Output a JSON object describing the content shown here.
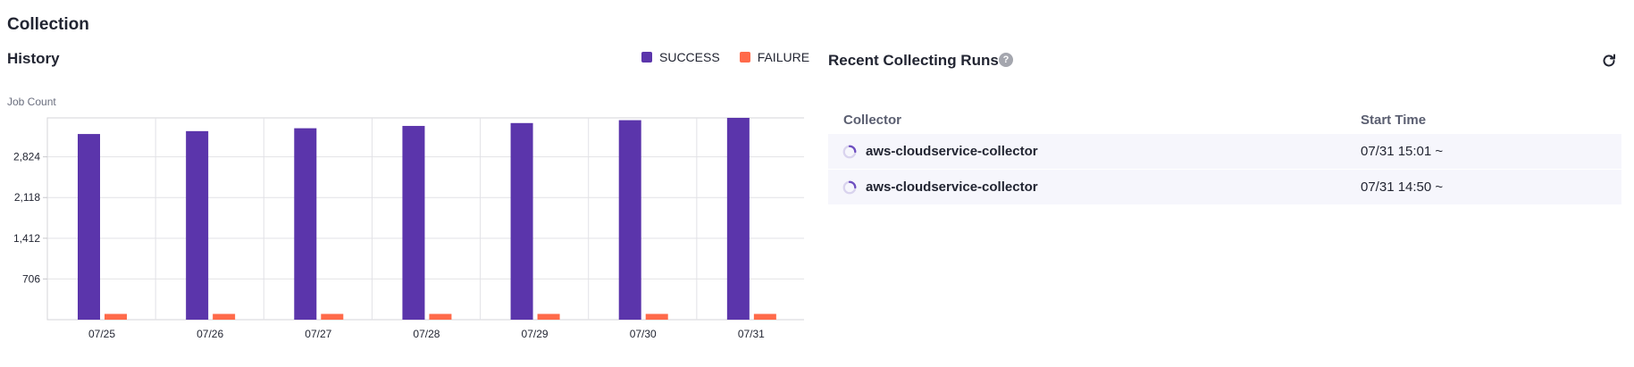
{
  "page": {
    "title": "Collection"
  },
  "history": {
    "title": "History",
    "y_axis_label": "Job Count",
    "legend": [
      {
        "label": "SUCCESS",
        "color": "#5b35ab"
      },
      {
        "label": "FAILURE",
        "color": "#ff6a4a"
      }
    ]
  },
  "chart_data": {
    "type": "bar",
    "categories": [
      "07/25",
      "07/26",
      "07/27",
      "07/28",
      "07/29",
      "07/30",
      "07/31"
    ],
    "series": [
      {
        "name": "SUCCESS",
        "color": "#5b35ab",
        "values": [
          3220,
          3270,
          3320,
          3360,
          3410,
          3460,
          3500
        ]
      },
      {
        "name": "FAILURE",
        "color": "#ff6a4a",
        "values": [
          100,
          100,
          100,
          100,
          100,
          100,
          100
        ]
      }
    ],
    "y_ticks": [
      "706",
      "1,412",
      "2,118",
      "2,824"
    ],
    "y_tick_values": [
      706,
      1412,
      2118,
      2824
    ],
    "ylim": [
      0,
      3500
    ],
    "grid": true,
    "legend_position": "top-right"
  },
  "recent_runs": {
    "title": "Recent Collecting Runs",
    "help_icon": "help-icon",
    "refresh_icon": "refresh-icon",
    "columns": {
      "collector": "Collector",
      "start_time": "Start Time"
    },
    "rows": [
      {
        "collector": "aws-cloudservice-collector",
        "start_time": "07/31 15:01 ~",
        "status_icon": "spinner-icon"
      },
      {
        "collector": "aws-cloudservice-collector",
        "start_time": "07/31 14:50 ~",
        "status_icon": "spinner-icon"
      }
    ]
  }
}
